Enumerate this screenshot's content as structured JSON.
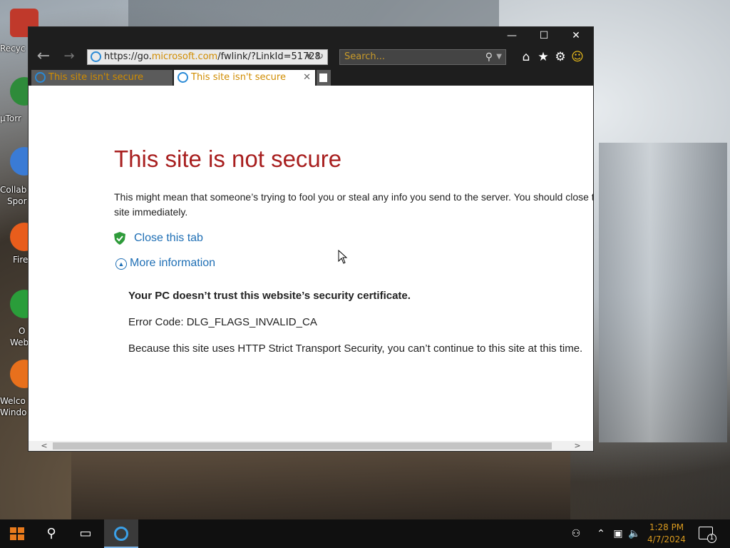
{
  "desktop": {
    "icons": [
      {
        "label": "Recyc",
        "color": "#c0392b"
      },
      {
        "label": "µTorr",
        "color": "#2e8b3a"
      },
      {
        "label": "Collab",
        "label2": "Spor",
        "color": "#3a7bd5"
      },
      {
        "label": "Fire",
        "color": "#e85d1c"
      },
      {
        "label": "O",
        "label2": "Web",
        "color": "#2a9d3a"
      },
      {
        "label": "Welco",
        "label2": "Windo",
        "color": "#e8701c"
      }
    ]
  },
  "browser": {
    "url_prefix": "https://go.",
    "url_domain": "microsoft.com",
    "url_suffix": "/fwlink/?LinkId=51728",
    "search_placeholder": "Search...",
    "tabs": [
      {
        "title": "This site isn't secure"
      },
      {
        "title": "This site isn't secure"
      }
    ],
    "controls": {
      "minimize": "—",
      "maximize": "☐",
      "close": "✕"
    }
  },
  "page": {
    "title": "This site is not secure",
    "description": "This might mean that someone’s trying to fool you or steal any info you send to the server. You should close this site immediately.",
    "close_tab": "Close this tab",
    "more_info": "More information",
    "cert_msg": "Your PC doesn’t trust this website’s security certificate.",
    "error_code": "Error Code: DLG_FLAGS_INVALID_CA",
    "hsts_msg": "Because this site uses HTTP Strict Transport Security, you can’t continue to this site at this time."
  },
  "taskbar": {
    "time": "1:28 PM",
    "date": "4/7/2024",
    "notification_count": "1"
  },
  "colors": {
    "error_title": "#a81f1f",
    "link": "#1f6fb5",
    "accent": "#d08c00"
  }
}
